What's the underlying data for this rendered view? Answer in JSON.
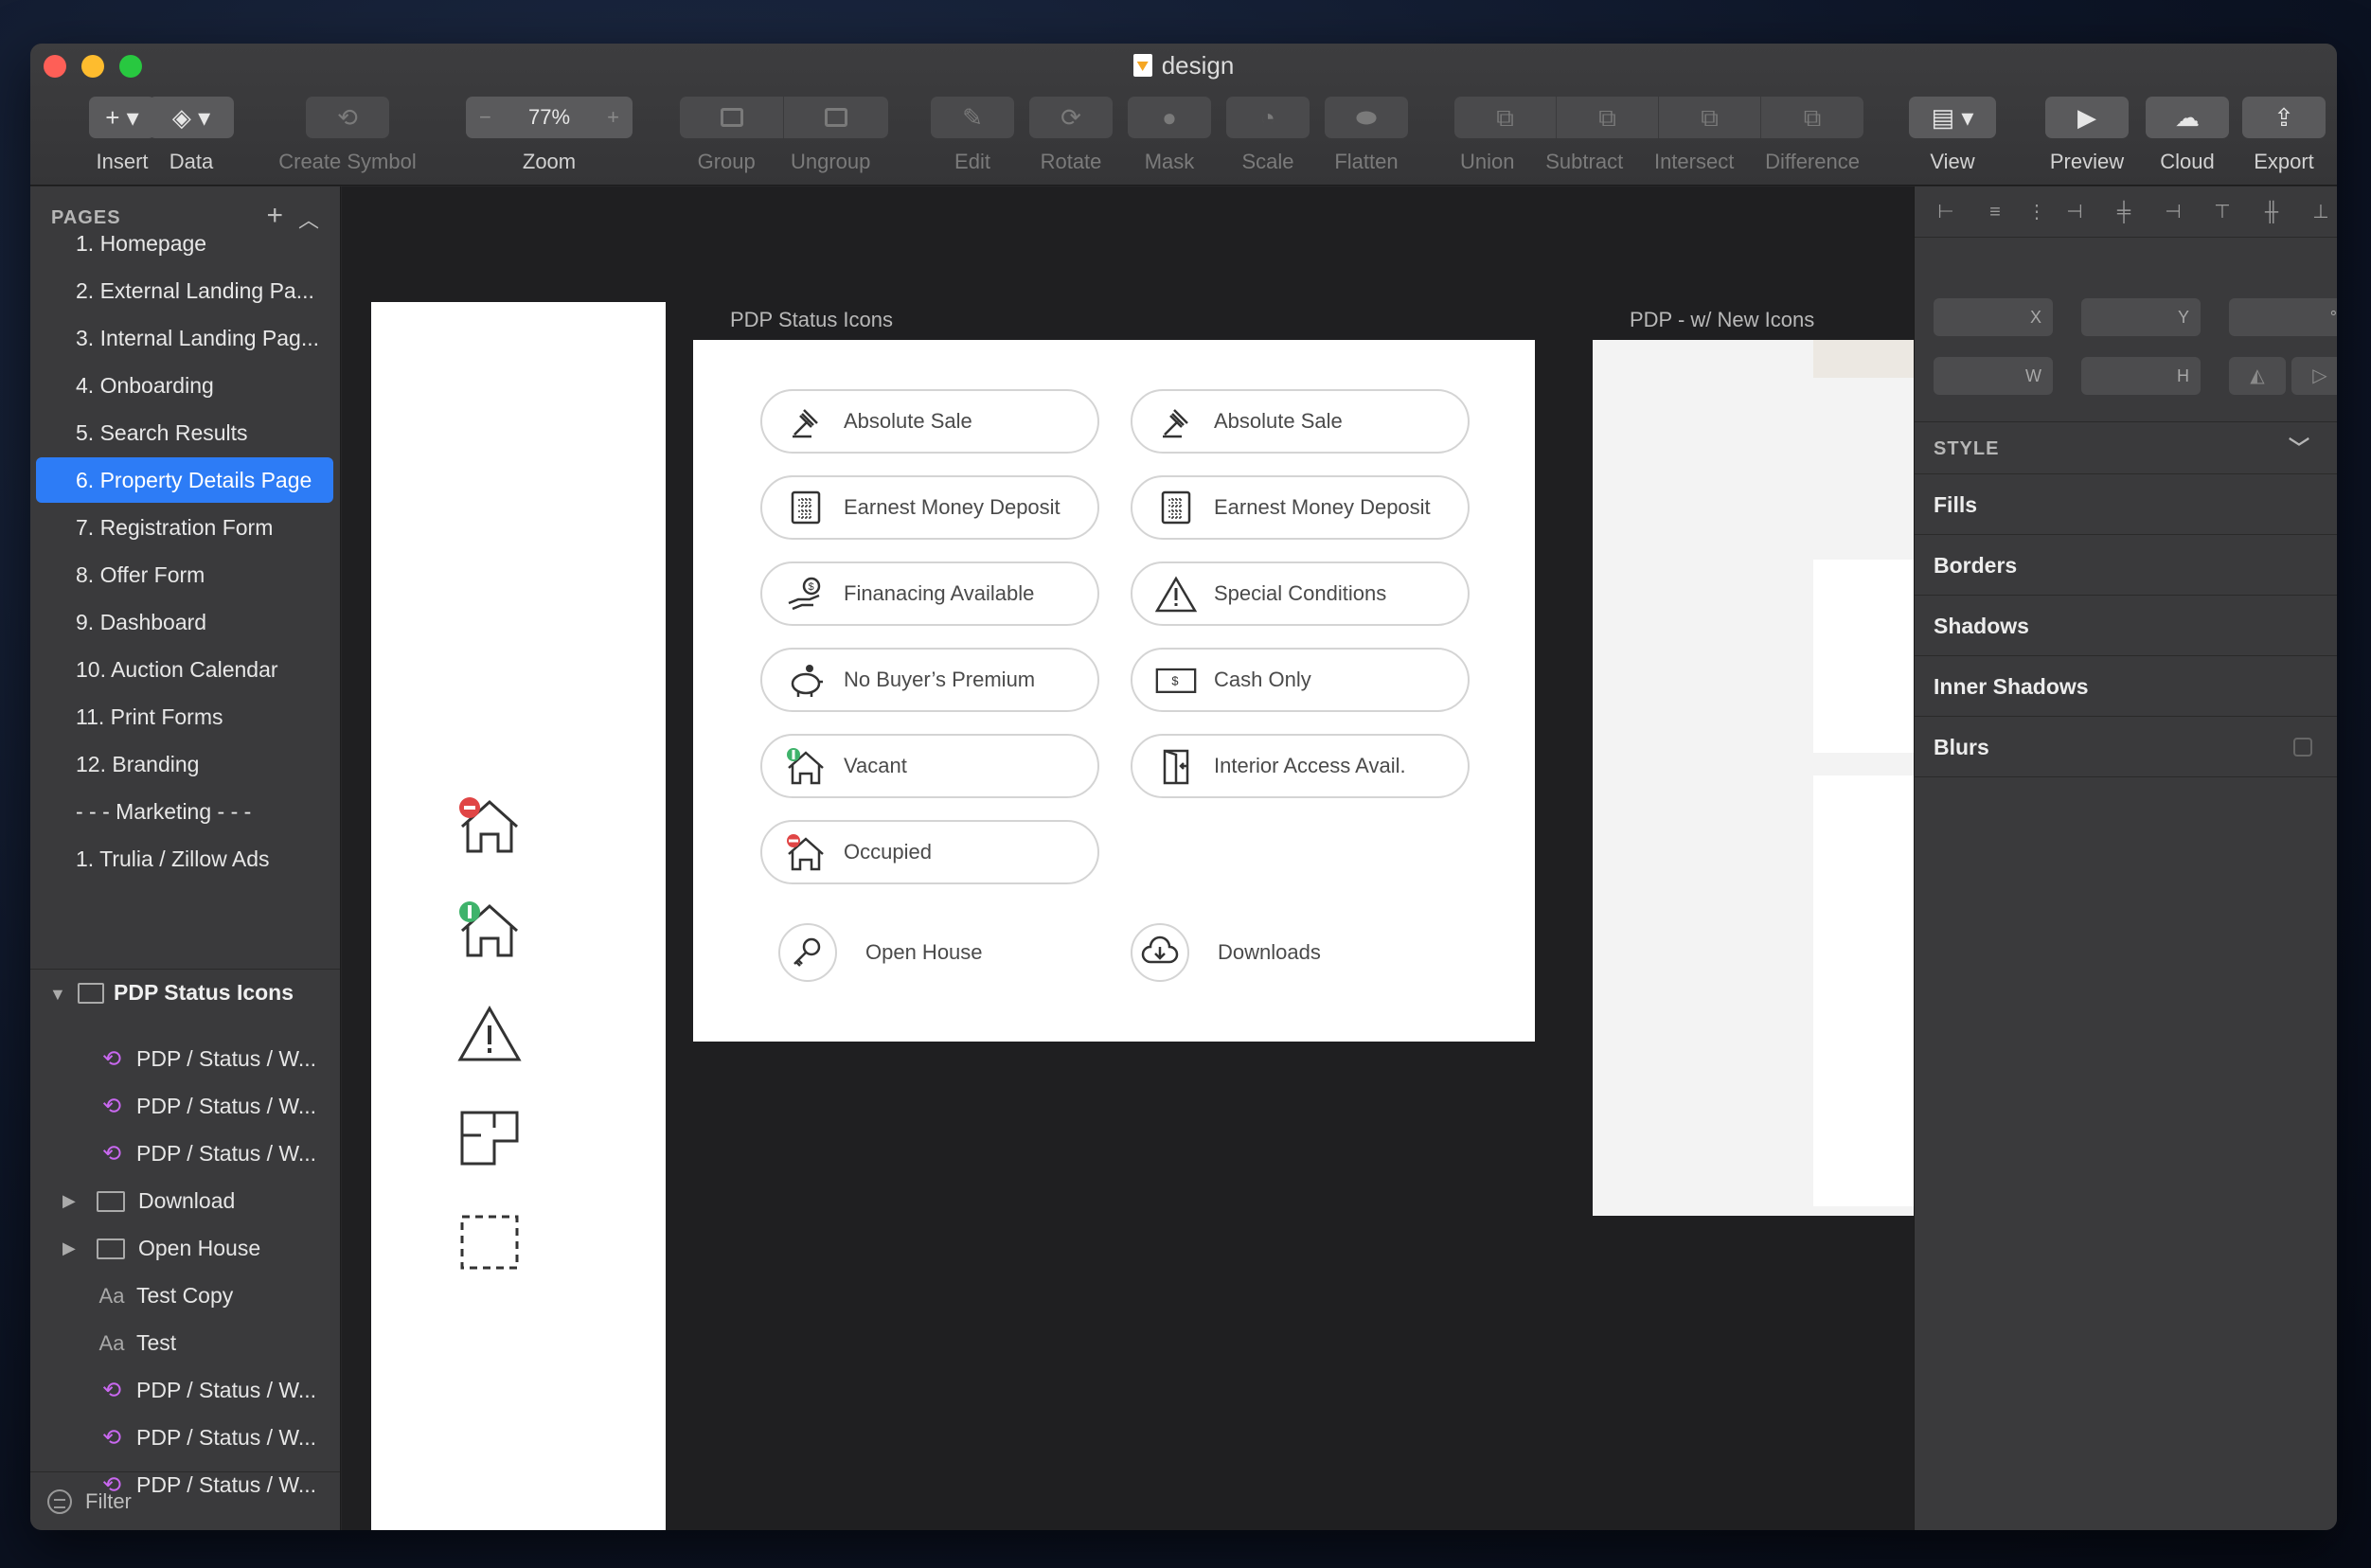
{
  "window": {
    "title": "design"
  },
  "toolbar": {
    "insert": "Insert",
    "data": "Data",
    "create_symbol": "Create Symbol",
    "zoom_value": "77%",
    "zoom": "Zoom",
    "group": "Group",
    "ungroup": "Ungroup",
    "edit": "Edit",
    "rotate": "Rotate",
    "mask": "Mask",
    "scale": "Scale",
    "flatten": "Flatten",
    "union": "Union",
    "subtract": "Subtract",
    "intersect": "Intersect",
    "difference": "Difference",
    "view": "View",
    "preview": "Preview",
    "cloud": "Cloud",
    "export": "Export"
  },
  "sidebar": {
    "pages_header": "PAGES",
    "pages": [
      "1. Homepage",
      "2. External Landing Pa...",
      "3. Internal Landing Pag...",
      "4. Onboarding",
      "5. Search Results",
      "6. Property Details Page",
      "7. Registration Form",
      "8. Offer Form",
      "9. Dashboard",
      "10. Auction Calendar",
      "11. Print Forms",
      "12. Branding",
      "- - - Marketing - - -",
      "1. Trulia / Zillow Ads"
    ],
    "active_page_index": 5,
    "layer_group": "PDP Status Icons",
    "layers": [
      {
        "type": "symbol",
        "label": "PDP / Status / W..."
      },
      {
        "type": "symbol",
        "label": "PDP / Status / W..."
      },
      {
        "type": "symbol",
        "label": "PDP / Status / W..."
      },
      {
        "type": "folder",
        "label": "Download"
      },
      {
        "type": "folder",
        "label": "Open House"
      },
      {
        "type": "text",
        "label": "Test Copy"
      },
      {
        "type": "text",
        "label": "Test"
      },
      {
        "type": "symbol",
        "label": "PDP / Status / W..."
      },
      {
        "type": "symbol",
        "label": "PDP / Status / W..."
      },
      {
        "type": "symbol",
        "label": "PDP / Status / W..."
      }
    ],
    "filter": "Filter"
  },
  "canvas": {
    "artboard_main_title": "PDP Status Icons",
    "artboard_right_title": "PDP - w/ New Icons",
    "pills": [
      {
        "label": "Absolute Sale",
        "icon": "gavel-icon"
      },
      {
        "label": "Absolute Sale",
        "icon": "gavel-icon"
      },
      {
        "label": "Earnest Money Deposit",
        "icon": "calculator-icon"
      },
      {
        "label": "Earnest Money Deposit",
        "icon": "calculator-icon"
      },
      {
        "label": "Finanacing Available",
        "icon": "hand-money-icon"
      },
      {
        "label": "Special Conditions",
        "icon": "warning-icon"
      },
      {
        "label": "No Buyer’s Premium",
        "icon": "piggy-bank-icon"
      },
      {
        "label": "Cash Only",
        "icon": "cash-icon"
      },
      {
        "label": "Vacant",
        "icon": "house-vacant-icon"
      },
      {
        "label": "Interior Access Avail.",
        "icon": "door-icon"
      },
      {
        "label": "Occupied",
        "icon": "house-occupied-icon"
      }
    ],
    "extras": [
      {
        "label": "Open House",
        "icon": "key-icon"
      },
      {
        "label": "Downloads",
        "icon": "cloud-download-icon"
      }
    ]
  },
  "inspector": {
    "x_label": "X",
    "y_label": "Y",
    "rotation_label": "°",
    "w_label": "W",
    "h_label": "H",
    "style_header": "STYLE",
    "style_rows": [
      "Fills",
      "Borders",
      "Shadows",
      "Inner Shadows",
      "Blurs"
    ]
  },
  "colors": {
    "accent": "#2d7cf6",
    "symbol": "#c968f0",
    "status_red": "#e04545",
    "status_green": "#3fb36b"
  }
}
